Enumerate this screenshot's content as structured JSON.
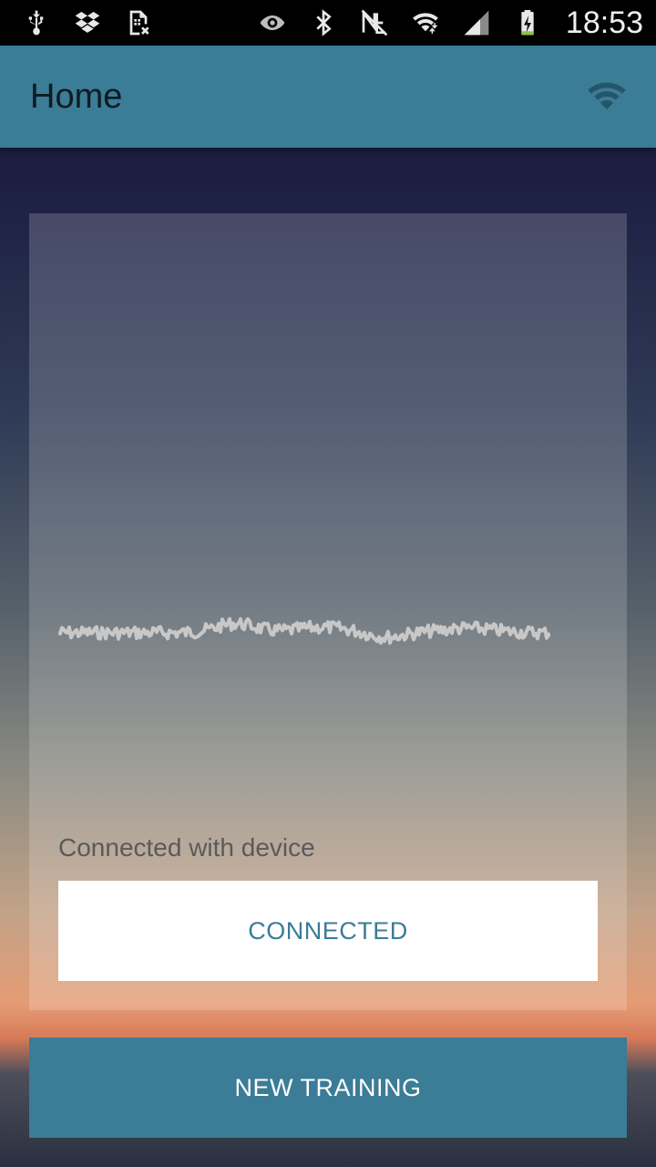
{
  "status_bar": {
    "time": "18:53",
    "left_icons": [
      "usb-icon",
      "dropbox-icon",
      "sim-error-icon"
    ],
    "right_icons": [
      "eye-icon",
      "bluetooth-icon",
      "nfc-icon",
      "wifi-signal-icon",
      "cell-signal-icon",
      "battery-charging-icon"
    ]
  },
  "app_bar": {
    "title": "Home",
    "action_icon": "wifi-icon"
  },
  "card": {
    "status_text": "Connected with device",
    "connected_button_label": "CONNECTED"
  },
  "actions": {
    "new_training_label": "NEW TRAINING"
  },
  "colors": {
    "accent": "#3b7c96",
    "waveform": "#c8c8c8"
  }
}
